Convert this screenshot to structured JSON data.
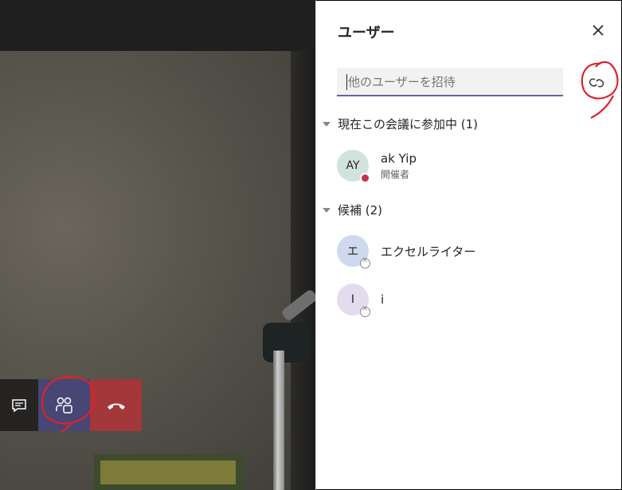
{
  "panel": {
    "title": "ユーザー",
    "search_placeholder": "他のユーザーを招待",
    "in_meeting_header": "現在この会議に参加中 (1)",
    "suggestions_header": "候補 (2)"
  },
  "participants": [
    {
      "initials": "AY",
      "name": "ak Yip",
      "role": "開催者",
      "status": "busy",
      "avatar_color": "#d0e4dd"
    }
  ],
  "suggestions": [
    {
      "initials": "エ",
      "name": "エクセルライター",
      "status": "offline",
      "avatar_color": "#cfd9ee"
    },
    {
      "initials": "I",
      "name": "i",
      "status": "offline",
      "avatar_color": "#e3dcef"
    }
  ],
  "colors": {
    "accent": "#6264a7",
    "hangup": "#a4373a",
    "annotation": "#e0202a"
  }
}
